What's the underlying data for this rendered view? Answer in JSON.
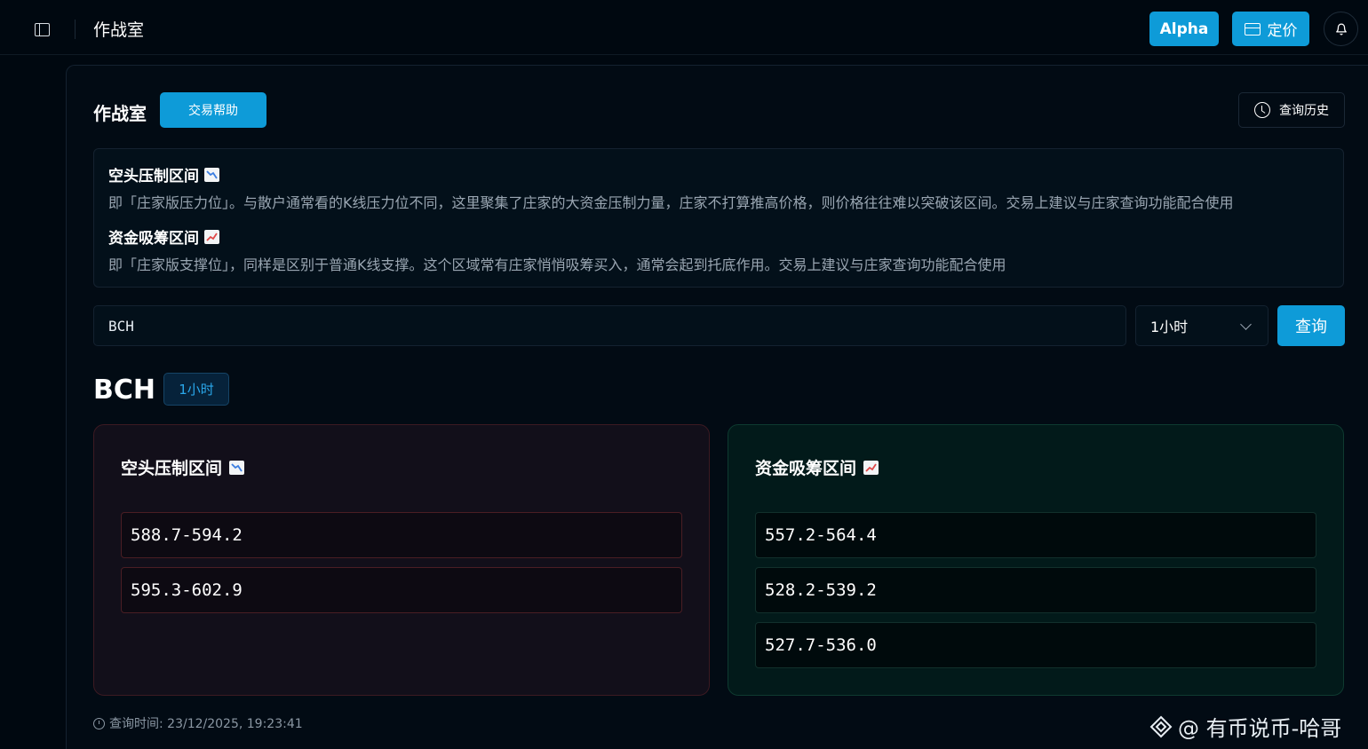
{
  "topbar": {
    "title": "作战室",
    "alpha_label": "Alpha",
    "pricing_label": "定价"
  },
  "header": {
    "title": "作战室",
    "help_label": "交易帮助",
    "history_label": "查询历史"
  },
  "info": {
    "resistance_title": "空头压制区间",
    "resistance_desc": "即「庄家版压力位」。与散户通常看的K线压力位不同，这里聚集了庄家的大资金压制力量，庄家不打算推高价格，则价格往往难以突破该区间。交易上建议与庄家查询功能配合使用",
    "support_title": "资金吸筹区间",
    "support_desc": "即「庄家版支撑位」，同样是区别于普通K线支撑。这个区域常有庄家悄悄吸筹买入，通常会起到托底作用。交易上建议与庄家查询功能配合使用"
  },
  "search": {
    "value": "BCH",
    "interval": "1小时",
    "query_label": "查询"
  },
  "result": {
    "symbol": "BCH",
    "interval": "1小时",
    "resistance": {
      "title": "空头压制区间",
      "zones": [
        "588.7-594.2",
        "595.3-602.9"
      ]
    },
    "support": {
      "title": "资金吸筹区间",
      "zones": [
        "557.2-564.4",
        "528.2-539.2",
        "527.7-536.0"
      ]
    },
    "query_time": "查询时间: 23/12/2025, 19:23:41"
  },
  "watermark": "@ 有币说币-哈哥",
  "colors": {
    "accent": "#0e9bd8",
    "bear_panel": "#120f1a",
    "bull_panel": "#021a1a",
    "bear_icon": "#3b7de0",
    "bull_icon": "#e04848"
  }
}
